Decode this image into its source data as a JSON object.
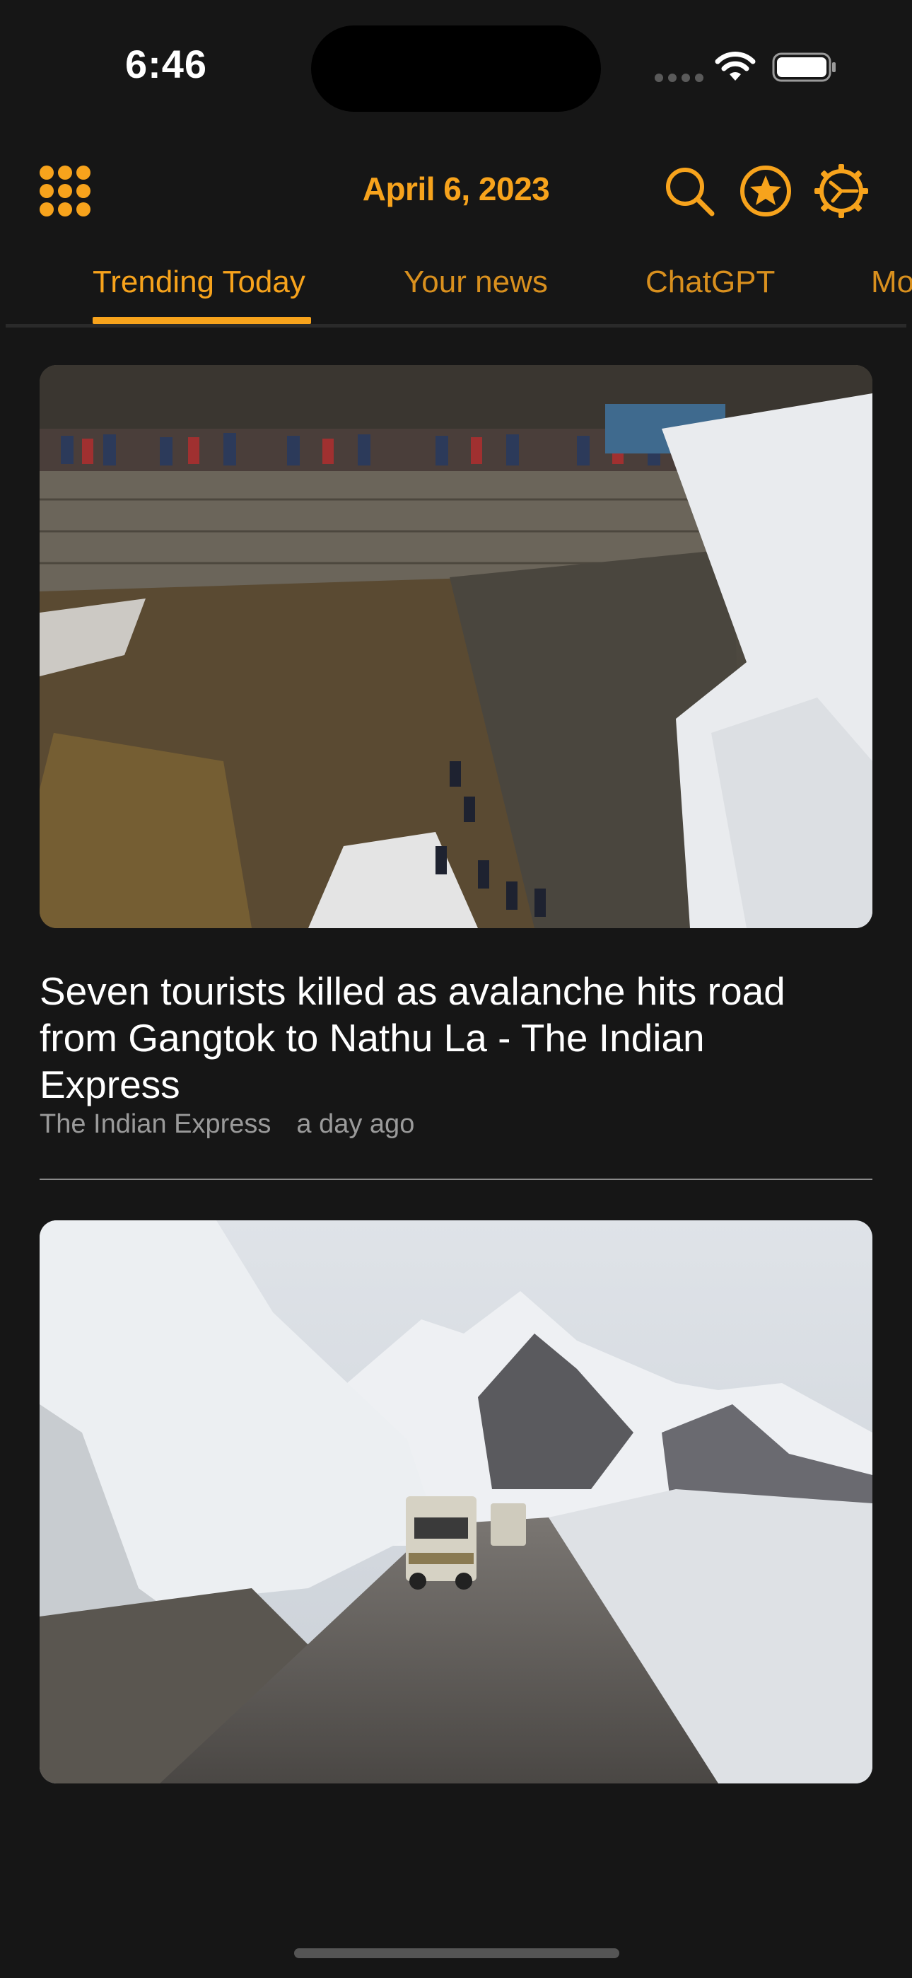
{
  "status_bar": {
    "time": "6:46"
  },
  "header": {
    "date": "April 6, 2023",
    "icons": {
      "menu": "grid-icon",
      "search": "search-icon",
      "favorites": "star-icon",
      "settings": "gear-icon"
    }
  },
  "tabs": [
    {
      "label": "Trending Today",
      "active": true
    },
    {
      "label": "Your news",
      "active": false
    },
    {
      "label": "ChatGPT",
      "active": false
    },
    {
      "label": "More",
      "active": false
    }
  ],
  "articles": [
    {
      "title": "Seven tourists killed as avalanche hits road from Gangtok to Nathu La - The Indian Express",
      "source": "The Indian Express",
      "time_ago": "a day ago"
    }
  ],
  "colors": {
    "accent": "#f7a31c",
    "background": "#161616",
    "text_primary": "#ffffff",
    "text_secondary": "#9a9a9a"
  }
}
